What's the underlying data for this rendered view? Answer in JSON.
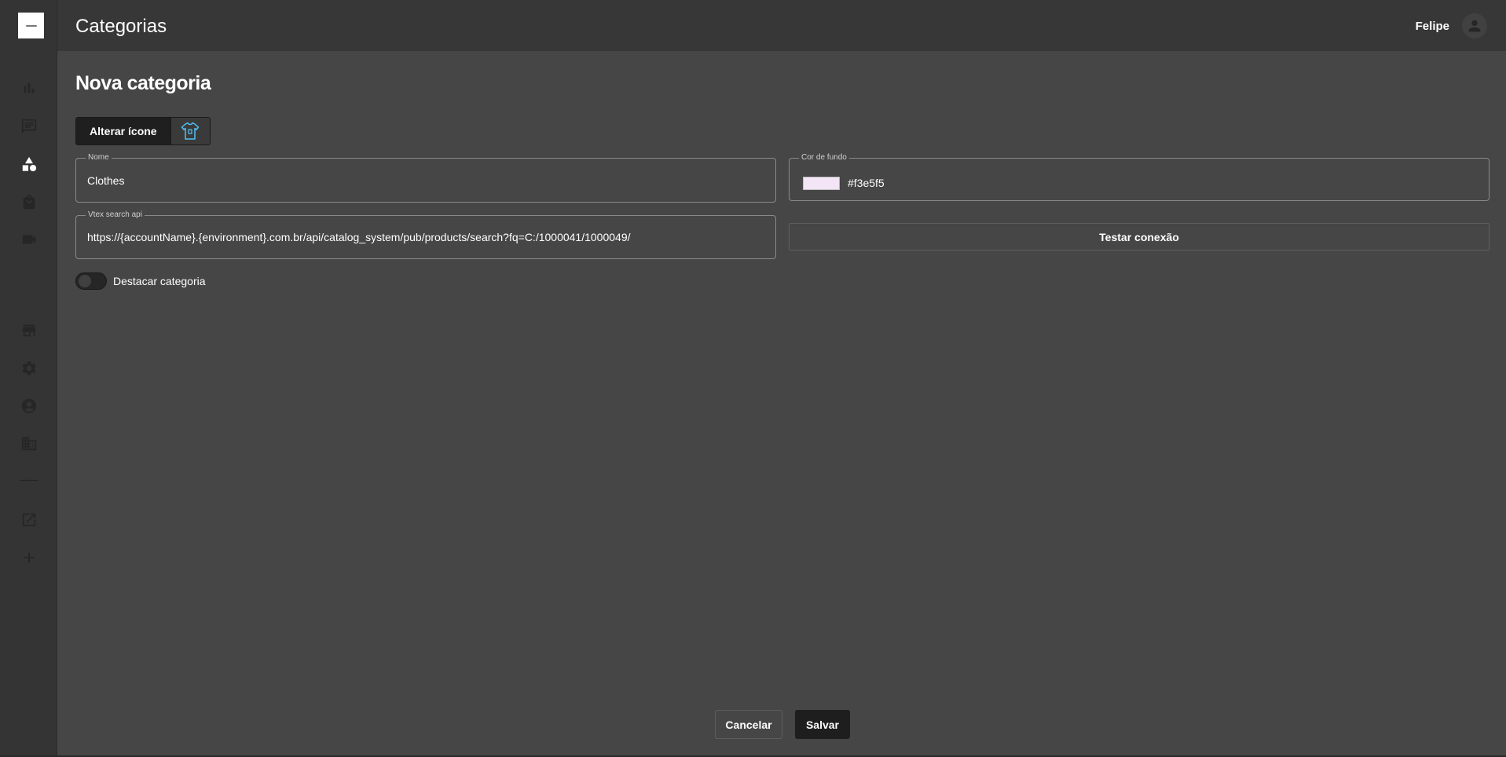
{
  "header": {
    "title": "Categorias",
    "user_name": "Felipe"
  },
  "sidebar": {
    "items": [
      {
        "icon": "bar-chart-icon",
        "active": false
      },
      {
        "icon": "message-icon",
        "active": false
      },
      {
        "icon": "category-shapes-icon",
        "active": true
      },
      {
        "icon": "shopping-bag-icon",
        "active": false
      },
      {
        "icon": "video-camera-icon",
        "active": false
      },
      {
        "icon": "store-icon",
        "active": false
      },
      {
        "icon": "gear-icon",
        "active": false
      },
      {
        "icon": "account-circle-icon",
        "active": false
      },
      {
        "icon": "business-icon",
        "active": false
      },
      {
        "icon": "open-external-icon",
        "active": false
      },
      {
        "icon": "plus-icon",
        "active": false
      }
    ]
  },
  "form": {
    "title": "Nova categoria",
    "change_icon_label": "Alterar ícone",
    "name_label": "Nome",
    "name_value": "Clothes",
    "bg_color_label": "Cor de fundo",
    "bg_color_value": "#f3e5f5",
    "api_label": "Vtex search api",
    "api_value": "https://{accountName}.{environment}.com.br/api/catalog_system/pub/products/search?fq=C:/1000041/1000049/",
    "test_connection_label": "Testar conexão",
    "highlight_label": "Destacar categoria",
    "highlight_on": false
  },
  "actions": {
    "cancel_label": "Cancelar",
    "save_label": "Salvar"
  },
  "colors": {
    "accent_icon": "#4fc3f7",
    "background": "#464646",
    "sidebar": "#343434",
    "header": "#373737"
  }
}
